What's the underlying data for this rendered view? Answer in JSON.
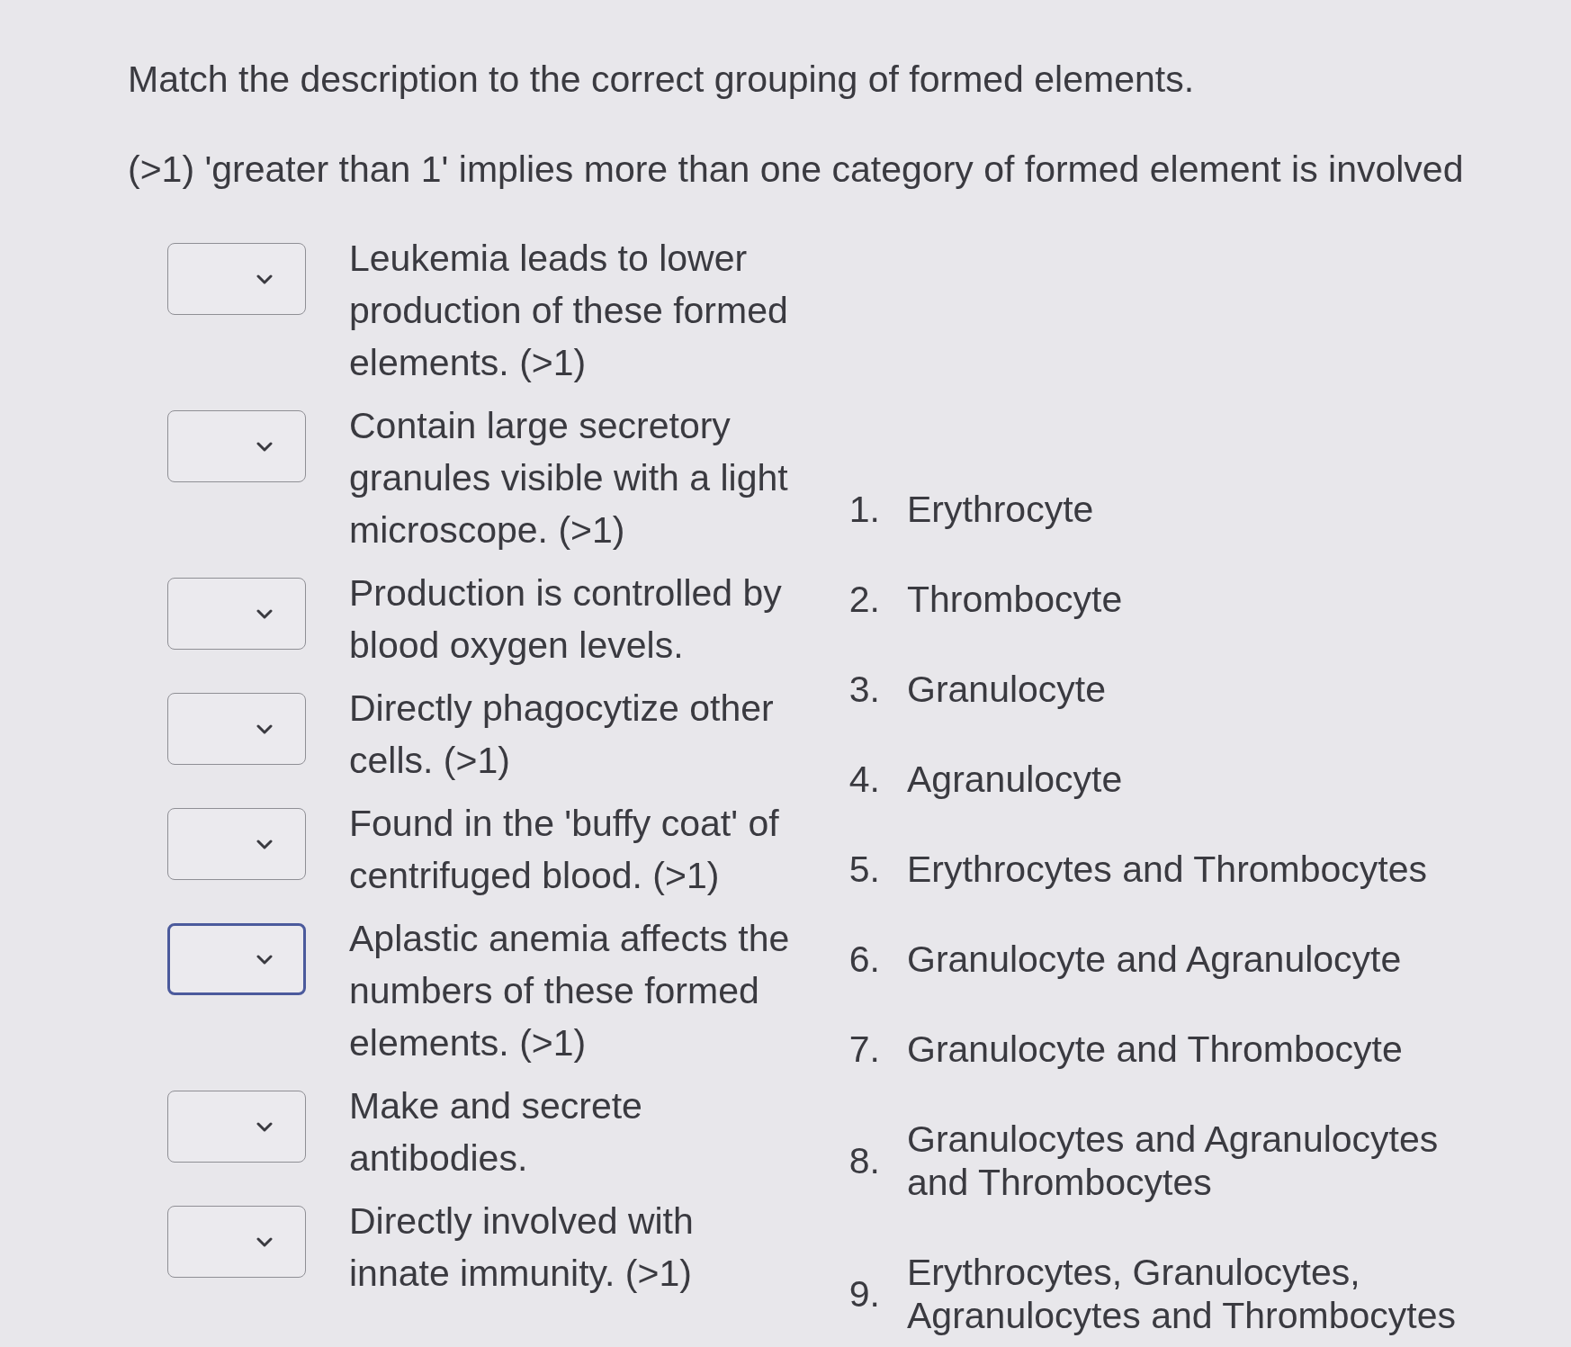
{
  "instructions": [
    "Match the description to the correct grouping of formed elements.",
    "(>1) 'greater than 1' implies more than one category of formed element is involved"
  ],
  "prompts": [
    {
      "text": "Leukemia leads to lower production of these formed elements. (>1)",
      "focused": false
    },
    {
      "text": "Contain large secretory granules visible with a light microscope. (>1)",
      "focused": false
    },
    {
      "text": "Production is controlled by blood oxygen levels.",
      "focused": false
    },
    {
      "text": "Directly phagocytize other cells. (>1)",
      "focused": false
    },
    {
      "text": "Found in the 'buffy coat' of centrifuged blood. (>1)",
      "focused": false
    },
    {
      "text": "Aplastic anemia affects the numbers of these formed elements. (>1)",
      "focused": true
    },
    {
      "text": "Make and secrete antibodies.",
      "focused": false
    },
    {
      "text": "Directly involved with innate immunity. (>1)",
      "focused": false
    }
  ],
  "options": [
    {
      "number": "1.",
      "text": "Erythrocyte"
    },
    {
      "number": "2.",
      "text": "Thrombocyte"
    },
    {
      "number": "3.",
      "text": "Granulocyte"
    },
    {
      "number": "4.",
      "text": "Agranulocyte"
    },
    {
      "number": "5.",
      "text": "Erythrocytes and Thrombocytes"
    },
    {
      "number": "6.",
      "text": "Granulocyte and Agranulocyte"
    },
    {
      "number": "7.",
      "text": "Granulocyte and Thrombocyte"
    },
    {
      "number": "8.",
      "text": "Granulocytes and Agranulocytes and Thrombocytes"
    },
    {
      "number": "9.",
      "text": "Erythrocytes, Granulocytes, Agranulocytes and Thrombocytes"
    }
  ]
}
